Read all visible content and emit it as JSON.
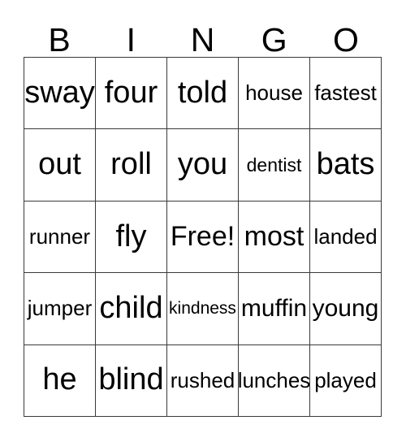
{
  "card": {
    "headers": [
      "B",
      "I",
      "N",
      "G",
      "O"
    ],
    "rows": [
      [
        {
          "text": "sway",
          "size": "s-xl"
        },
        {
          "text": "four",
          "size": "s-xl"
        },
        {
          "text": "told",
          "size": "s-xl"
        },
        {
          "text": "house",
          "size": "s-sm"
        },
        {
          "text": "fastest",
          "size": "s-sm"
        }
      ],
      [
        {
          "text": "out",
          "size": "s-xl"
        },
        {
          "text": "roll",
          "size": "s-xl"
        },
        {
          "text": "you",
          "size": "s-xl"
        },
        {
          "text": "dentist",
          "size": "s-xs"
        },
        {
          "text": "bats",
          "size": "s-xl"
        }
      ],
      [
        {
          "text": "runner",
          "size": "s-sm"
        },
        {
          "text": "fly",
          "size": "s-xl"
        },
        {
          "text": "Free!",
          "size": "s-lg"
        },
        {
          "text": "most",
          "size": "s-lg"
        },
        {
          "text": "landed",
          "size": "s-sm"
        }
      ],
      [
        {
          "text": "jumper",
          "size": "s-sm"
        },
        {
          "text": "child",
          "size": "s-xl"
        },
        {
          "text": "kindness",
          "size": "s-xxs"
        },
        {
          "text": "muffin",
          "size": "s-md"
        },
        {
          "text": "young",
          "size": "s-md"
        }
      ],
      [
        {
          "text": "he",
          "size": "s-xl"
        },
        {
          "text": "blind",
          "size": "s-xl"
        },
        {
          "text": "rushed",
          "size": "s-sm"
        },
        {
          "text": "lunches",
          "size": "s-sm"
        },
        {
          "text": "played",
          "size": "s-sm"
        }
      ]
    ],
    "free_space": {
      "row": 2,
      "col": 2,
      "label": "Free!"
    },
    "colors": {
      "background": "#ffffff",
      "text": "#000000",
      "border": "#3a3a3a"
    }
  }
}
